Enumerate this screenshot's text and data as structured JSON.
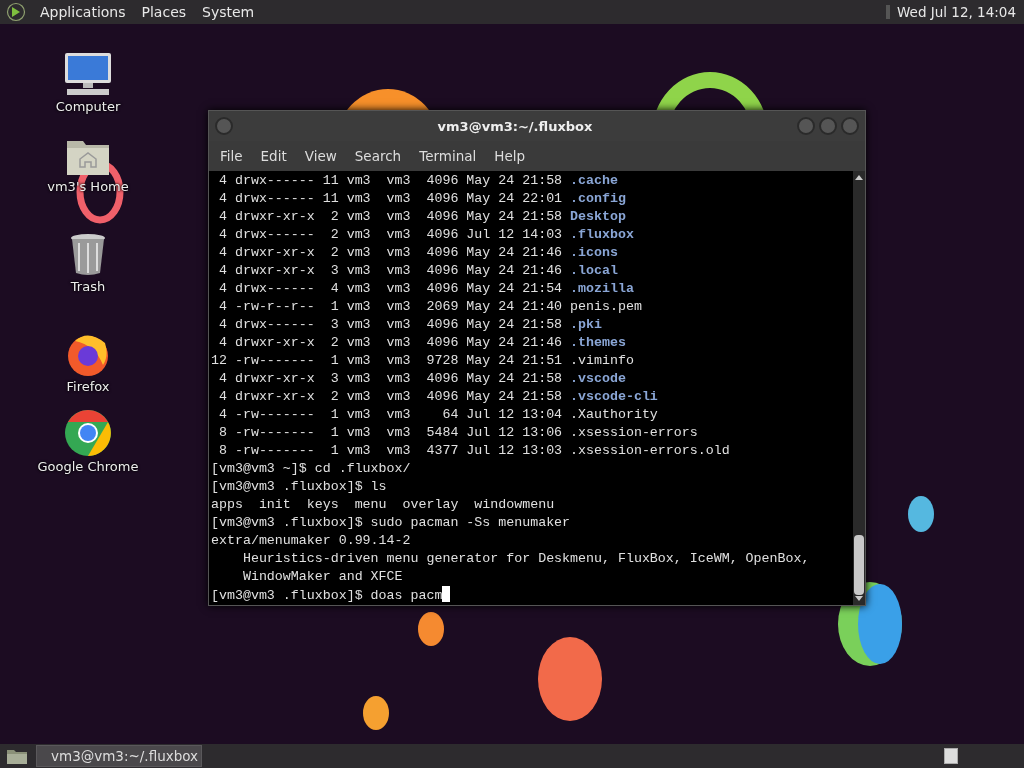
{
  "top_panel": {
    "menus": [
      "Applications",
      "Places",
      "System"
    ],
    "clock": "Wed Jul 12, 14:04"
  },
  "desktop_icons": [
    {
      "kind": "computer",
      "label": "Computer"
    },
    {
      "kind": "home",
      "label": "vm3's Home"
    },
    {
      "kind": "trash",
      "label": "Trash"
    },
    {
      "kind": "firefox",
      "label": "Firefox"
    },
    {
      "kind": "chrome",
      "label": "Google Chrome"
    }
  ],
  "terminal": {
    "title": "vm3@vm3:~/.fluxbox",
    "menu": [
      "File",
      "Edit",
      "View",
      "Search",
      "Terminal",
      "Help"
    ],
    "lines": [
      {
        "text": " 4 drwx------ 11 vm3  vm3  4096 May 24 21:58 ",
        "name": ".cache",
        "kind": "dir"
      },
      {
        "text": " 4 drwx------ 11 vm3  vm3  4096 May 24 22:01 ",
        "name": ".config",
        "kind": "dir"
      },
      {
        "text": " 4 drwxr-xr-x  2 vm3  vm3  4096 May 24 21:58 ",
        "name": "Desktop",
        "kind": "dir"
      },
      {
        "text": " 4 drwx------  2 vm3  vm3  4096 Jul 12 14:03 ",
        "name": ".fluxbox",
        "kind": "dir"
      },
      {
        "text": " 4 drwxr-xr-x  2 vm3  vm3  4096 May 24 21:46 ",
        "name": ".icons",
        "kind": "dir"
      },
      {
        "text": " 4 drwxr-xr-x  3 vm3  vm3  4096 May 24 21:46 ",
        "name": ".local",
        "kind": "dir"
      },
      {
        "text": " 4 drwx------  4 vm3  vm3  4096 May 24 21:54 ",
        "name": ".mozilla",
        "kind": "dir"
      },
      {
        "text": " 4 -rw-r--r--  1 vm3  vm3  2069 May 24 21:40 ",
        "name": "penis.pem",
        "kind": "file"
      },
      {
        "text": " 4 drwx------  3 vm3  vm3  4096 May 24 21:58 ",
        "name": ".pki",
        "kind": "dir"
      },
      {
        "text": " 4 drwxr-xr-x  2 vm3  vm3  4096 May 24 21:46 ",
        "name": ".themes",
        "kind": "dir"
      },
      {
        "text": "12 -rw-------  1 vm3  vm3  9728 May 24 21:51 ",
        "name": ".viminfo",
        "kind": "file"
      },
      {
        "text": " 4 drwxr-xr-x  3 vm3  vm3  4096 May 24 21:58 ",
        "name": ".vscode",
        "kind": "dir"
      },
      {
        "text": " 4 drwxr-xr-x  2 vm3  vm3  4096 May 24 21:58 ",
        "name": ".vscode-cli",
        "kind": "dir"
      },
      {
        "text": " 4 -rw-------  1 vm3  vm3    64 Jul 12 13:04 ",
        "name": ".Xauthority",
        "kind": "file"
      },
      {
        "text": " 8 -rw-------  1 vm3  vm3  5484 Jul 12 13:06 ",
        "name": ".xsession-errors",
        "kind": "file"
      },
      {
        "text": " 8 -rw-------  1 vm3  vm3  4377 Jul 12 13:03 ",
        "name": ".xsession-errors.old",
        "kind": "file"
      },
      {
        "text": "[vm3@vm3 ~]$ cd .fluxbox/",
        "kind": "plain"
      },
      {
        "text": "[vm3@vm3 .fluxbox]$ ls",
        "kind": "plain"
      },
      {
        "text": "apps  init  keys  menu  overlay  windowmenu",
        "kind": "plain"
      },
      {
        "text": "[vm3@vm3 .fluxbox]$ sudo pacman -Ss menumaker",
        "kind": "plain"
      },
      {
        "text": "extra/menumaker 0.99.14-2",
        "kind": "plain"
      },
      {
        "text": "    Heuristics-driven menu generator for Deskmenu, FluxBox, IceWM, OpenBox,",
        "kind": "plain"
      },
      {
        "text": "    WindowMaker and XFCE",
        "kind": "plain"
      },
      {
        "text": "[vm3@vm3 .fluxbox]$ doas pacm",
        "kind": "prompt"
      }
    ]
  },
  "bottom_panel": {
    "tasks": [
      {
        "label": "vm3@vm3:~/.fluxbox",
        "selected": true
      }
    ]
  }
}
